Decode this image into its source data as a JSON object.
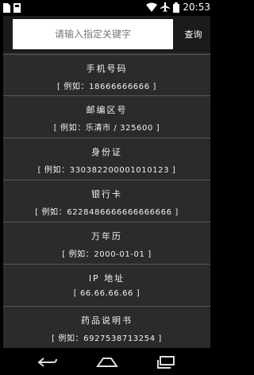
{
  "status_bar": {
    "time": "20:53",
    "icons": [
      "sim-card-icon",
      "sd-card-icon",
      "wifi-icon",
      "airplane-icon",
      "battery-icon"
    ]
  },
  "search": {
    "placeholder": "请输入指定关键字",
    "button_label": "查询"
  },
  "items": [
    {
      "title": "手机号码",
      "example": "[ 例如：18666666666 ]"
    },
    {
      "title": "邮编区号",
      "example": "[ 例如：乐清市 / 325600 ]"
    },
    {
      "title": "身份证",
      "example": "[ 例如：330382200001010123 ]"
    },
    {
      "title": "银行卡",
      "example": "[ 例如：6228486666666666666 ]"
    },
    {
      "title": "万年历",
      "example": "[ 例如：2000-01-01 ]"
    },
    {
      "title": "IP 地址",
      "example": "[ 66.66.66.66 ]"
    },
    {
      "title": "药品说明书",
      "example": "[ 例如：6927538713254 ]"
    }
  ],
  "nav": {
    "icons": [
      "back-icon",
      "home-icon",
      "recent-apps-icon"
    ]
  }
}
